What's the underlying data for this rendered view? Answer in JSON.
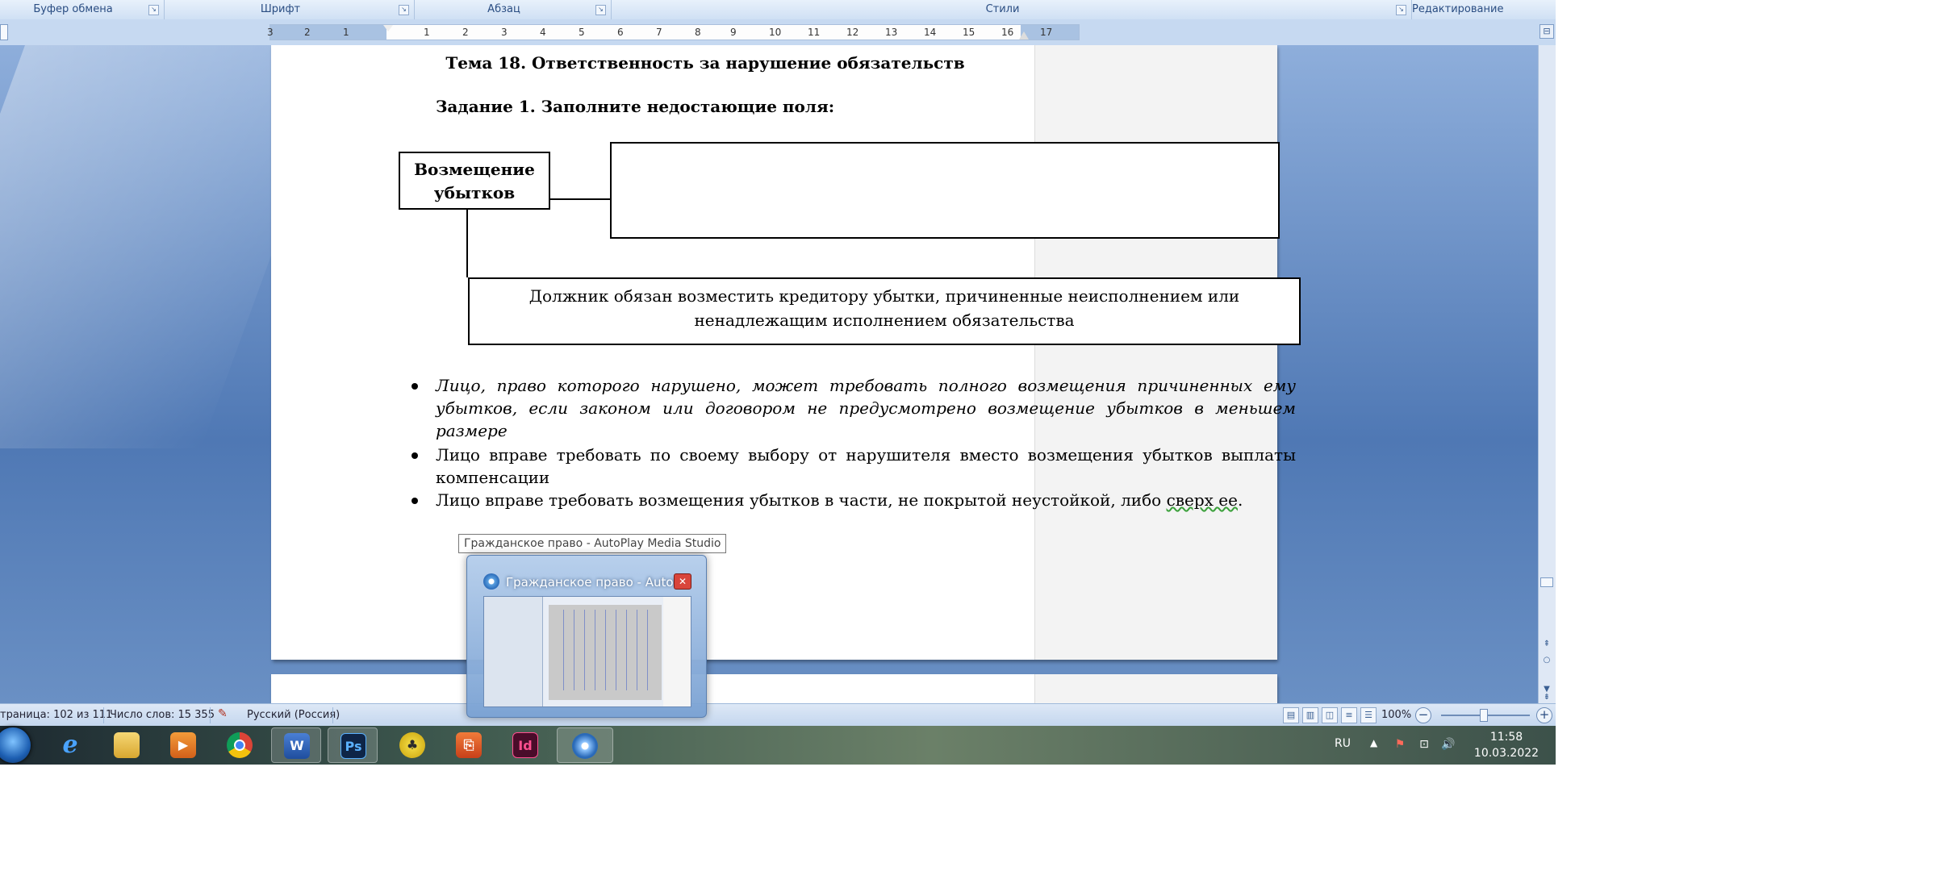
{
  "ribbon": {
    "groups": [
      "Буфер обмена",
      "Шрифт",
      "Абзац",
      "Стили",
      "Редактирование"
    ]
  },
  "ruler": {
    "numbers": [
      "3",
      "2",
      "1",
      "1",
      "2",
      "3",
      "4",
      "5",
      "6",
      "7",
      "8",
      "9",
      "10",
      "11",
      "12",
      "13",
      "14",
      "15",
      "16",
      "17"
    ]
  },
  "document": {
    "title": "Тема 18. Ответственность за нарушение обязательств",
    "task": "Задание 1. Заполните недостающие поля:",
    "diagram": {
      "left_box": "Возмещение убытков",
      "right_box": "",
      "bottom_box": "Должник обязан возместить кредитору убытки, причиненные неисполнением или ненадлежащим исполнением обязательства"
    },
    "bullets": [
      "Лицо, право которого нарушено, может требовать полного возмещения причиненных ему убытков, если законом или договором не предусмотрено возмещение убытков в меньшем размере",
      "Лицо вправе требовать по своему выбору от нарушителя вместо возмещения убытков выплаты компенсации",
      "Лицо вправе требовать возмещения убытков в части, не покрытой неустойкой, либо"
    ],
    "bullet3_tail_underlined": "сверх ее",
    "bullet3_end": "."
  },
  "tooltip": "Гражданское право - AutoPlay Media Studio",
  "preview": {
    "title": "Гражданское право - AutoP...",
    "close_icon": "close-icon"
  },
  "statusbar": {
    "page": "траница: 102 из 111",
    "words": "Число слов: 15 355",
    "language": "Русский (Россия)",
    "zoom": "100%"
  },
  "taskbar": {
    "apps": [
      "internet-explorer",
      "file-explorer",
      "media-player",
      "chrome",
      "word",
      "photoshop",
      "app-yellow",
      "acrobat",
      "indesign",
      "autoplay"
    ],
    "word_label": "W",
    "ps_label": "Ps",
    "id_label": "Id"
  },
  "tray": {
    "lang": "RU",
    "time": "11:58",
    "date": "10.03.2022"
  }
}
